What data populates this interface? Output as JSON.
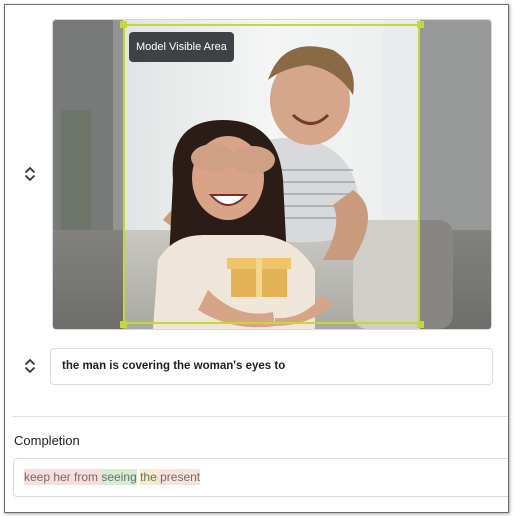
{
  "image_panel": {
    "visible_area_label": "Model Visible Area",
    "image_subject": "couple-surprise-gift-photo",
    "crop_color": "#c6d833"
  },
  "prompt": {
    "text": "the man is covering the woman's eyes to"
  },
  "completion": {
    "label": "Completion",
    "tokens": [
      {
        "text": "keep her from ",
        "color": "#f9dcdc"
      },
      {
        "text": "seeing",
        "color": "#d6ecd2"
      },
      {
        "text": " ",
        "color": "#ffffff"
      },
      {
        "text": "the",
        "color": "#f6edc6"
      },
      {
        "text": " present",
        "color": "#f9e2dc"
      }
    ]
  },
  "icons": {
    "reorder_handle": "chevron-up-down-icon"
  }
}
